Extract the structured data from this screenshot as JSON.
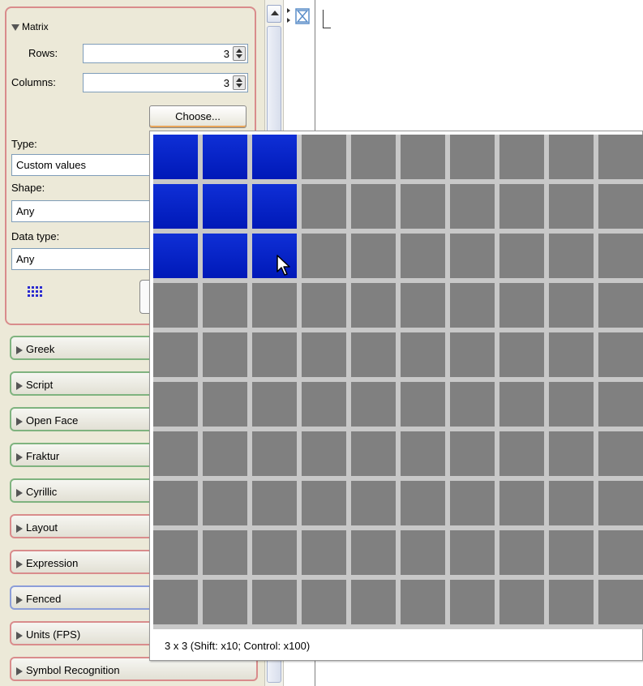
{
  "palette": {
    "matrix": {
      "title": "Matrix",
      "rows_label": "Rows:",
      "rows_value": "3",
      "columns_label": "Columns:",
      "columns_value": "3",
      "choose_label": "Choose...",
      "type_label": "Type:",
      "type_value": "Custom values",
      "shape_label": "Shape:",
      "shape_value": "Any",
      "datatype_label": "Data type:",
      "datatype_value": "Any"
    },
    "categories": [
      {
        "label": "Greek",
        "color": "#7fb37f"
      },
      {
        "label": "Script",
        "color": "#7fb37f"
      },
      {
        "label": "Open Face",
        "color": "#7fb37f"
      },
      {
        "label": "Fraktur",
        "color": "#7fb37f"
      },
      {
        "label": "Cyrillic",
        "color": "#7fb37f"
      },
      {
        "label": "Layout",
        "color": "#d98c8c"
      },
      {
        "label": "Expression",
        "color": "#d98c8c"
      },
      {
        "label": "Fenced",
        "color": "#8c9ed9"
      },
      {
        "label": "Units (FPS)",
        "color": "#d98c8c"
      },
      {
        "label": "Symbol Recognition",
        "color": "#d98c8c"
      }
    ]
  },
  "chooser": {
    "selected_rows": 3,
    "selected_columns": 3,
    "visible_rows": 10,
    "visible_columns": 10,
    "selected_color": "#0022cc",
    "cell_color": "#808080",
    "status": "3 x 3 (Shift: x10; Control: x100)"
  }
}
